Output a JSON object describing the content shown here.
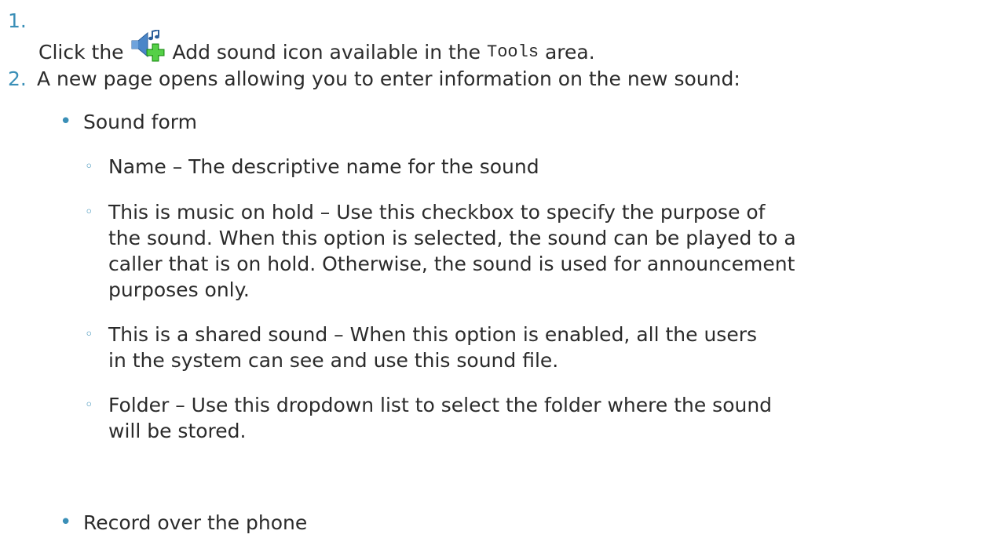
{
  "steps": [
    {
      "number": "1.",
      "text_before": "Click the",
      "icon": "add-sound-icon",
      "text_after": "Add sound icon available in the",
      "code": "Tools",
      "text_end": "area."
    },
    {
      "number": "2.",
      "text": "A new page opens allowing you to enter information on the new sound:"
    }
  ],
  "sections": [
    {
      "label": "Sound form",
      "items": [
        {
          "lines": [
            "Name – The descriptive name for the sound"
          ]
        },
        {
          "lines": [
            "This is music on hold – Use this checkbox to specify the purpose of",
            "the sound. When this option is selected, the sound can be played to a",
            "caller that is on hold. Otherwise, the sound is used for announcement",
            "purposes only."
          ]
        },
        {
          "lines": [
            "This is a shared sound – When this option is enabled, all the users",
            "in the system can see and use this sound file."
          ]
        },
        {
          "lines": [
            "Folder – Use this dropdown list to select the folder where the sound",
            "will be stored."
          ]
        }
      ]
    },
    {
      "label": "Record over the phone"
    }
  ],
  "colors": {
    "accent": "#3a8fb7",
    "text": "#2b2b2b",
    "icon_plus": "#3cbf2e",
    "icon_speaker": "#4a86c8"
  }
}
